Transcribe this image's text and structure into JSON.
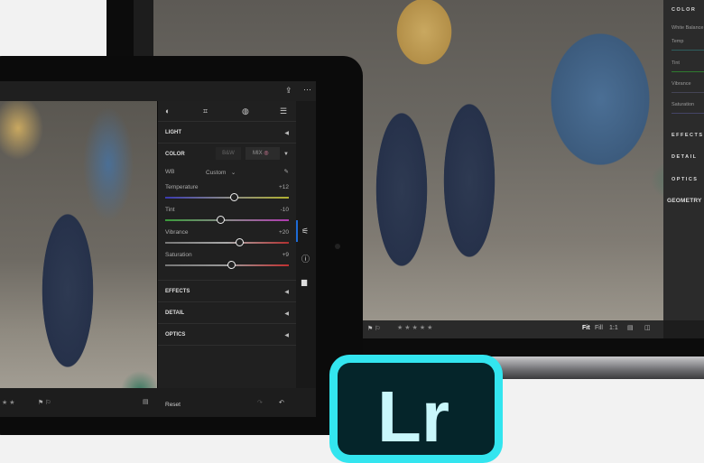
{
  "laptop": {
    "panel": {
      "color": "COLOR",
      "white_balance": "White Balance",
      "temp": "Temp",
      "tint": "Tint",
      "vibrance": "Vibrance",
      "saturation": "Saturation",
      "effects": "EFFECTS",
      "detail": "DETAIL",
      "optics": "OPTICS",
      "geometry": "GEOMETRY"
    },
    "toolbar": {
      "stars": "★★★★★",
      "fit": "Fit",
      "fill": "Fill",
      "one_to_one": "1:1"
    }
  },
  "tablet": {
    "panel": {
      "light": "LIGHT",
      "color": "COLOR",
      "bw": "B&W",
      "mix": "MIX",
      "wb_label": "WB",
      "wb_value": "Custom",
      "sliders": [
        {
          "label": "Temperature",
          "value": "+12",
          "position": 0.56
        },
        {
          "label": "Tint",
          "value": "-10",
          "position": 0.45
        },
        {
          "label": "Vibrance",
          "value": "+20",
          "position": 0.6
        },
        {
          "label": "Saturation",
          "value": "+9",
          "position": 0.54
        }
      ],
      "effects": "EFFECTS",
      "detail": "DETAIL",
      "optics": "OPTICS"
    },
    "bottom": {
      "stars": "★ ★",
      "reset": "Reset"
    }
  },
  "logo": {
    "text": "Lr"
  }
}
